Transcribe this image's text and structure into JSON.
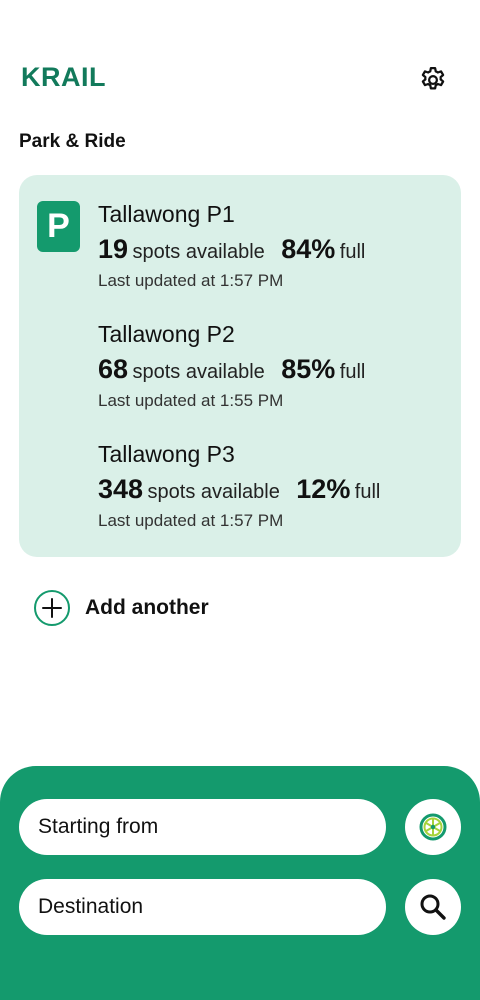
{
  "app": {
    "title": "KRAIL"
  },
  "icons": {
    "settings": "gear-icon",
    "parking": "parking-p-icon",
    "add": "plus-circle-icon",
    "locate": "wheel-icon",
    "search": "search-icon"
  },
  "colors": {
    "brand": "#149a6d",
    "title": "#127a5b",
    "card_bg": "#daf0e8"
  },
  "section": {
    "title": "Park & Ride"
  },
  "card": {
    "badge": "P",
    "lots": [
      {
        "name": "Tallawong P1",
        "spots": "19",
        "spots_label": "spots available",
        "percent": "84%",
        "percent_label": "full",
        "updated": "Last updated at 1:57 PM"
      },
      {
        "name": "Tallawong P2",
        "spots": "68",
        "spots_label": "spots available",
        "percent": "85%",
        "percent_label": "full",
        "updated": "Last updated at 1:55 PM"
      },
      {
        "name": "Tallawong P3",
        "spots": "348",
        "spots_label": "spots available",
        "percent": "12%",
        "percent_label": "full",
        "updated": "Last updated at 1:57 PM"
      }
    ]
  },
  "add": {
    "label": "Add another"
  },
  "search": {
    "from_placeholder": "Starting from",
    "to_placeholder": "Destination"
  }
}
